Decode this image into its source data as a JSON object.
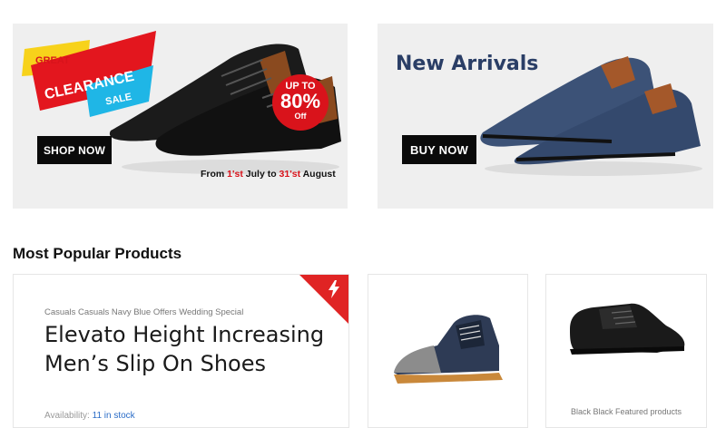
{
  "banner_clearance": {
    "ribbon_great": "GREAT",
    "ribbon_clearance": "CLEARANCE",
    "ribbon_sale": "SALE",
    "badge_up_to": "UP TO",
    "badge_percent": "80%",
    "badge_off": "Off",
    "button_label": "SHOP NOW",
    "date_prefix": "From ",
    "date_start": "1'st",
    "date_mid": " July to ",
    "date_end": "31'st",
    "date_suffix": " August"
  },
  "banner_new": {
    "title": "New Arrivals",
    "button_label": "BUY NOW"
  },
  "section": {
    "title": "Most Popular Products"
  },
  "products": [
    {
      "category": "Casuals Casuals Navy Blue Offers Wedding Special",
      "title": "Elevato Height Increasing Men’s Slip On Shoes",
      "availability_label": "Availability: ",
      "availability_value": "11 in stock"
    },
    {
      "category": "Black Black Featured products"
    }
  ],
  "colors": {
    "accent_red": "#d9131b",
    "navy_text": "#2a3e66"
  }
}
